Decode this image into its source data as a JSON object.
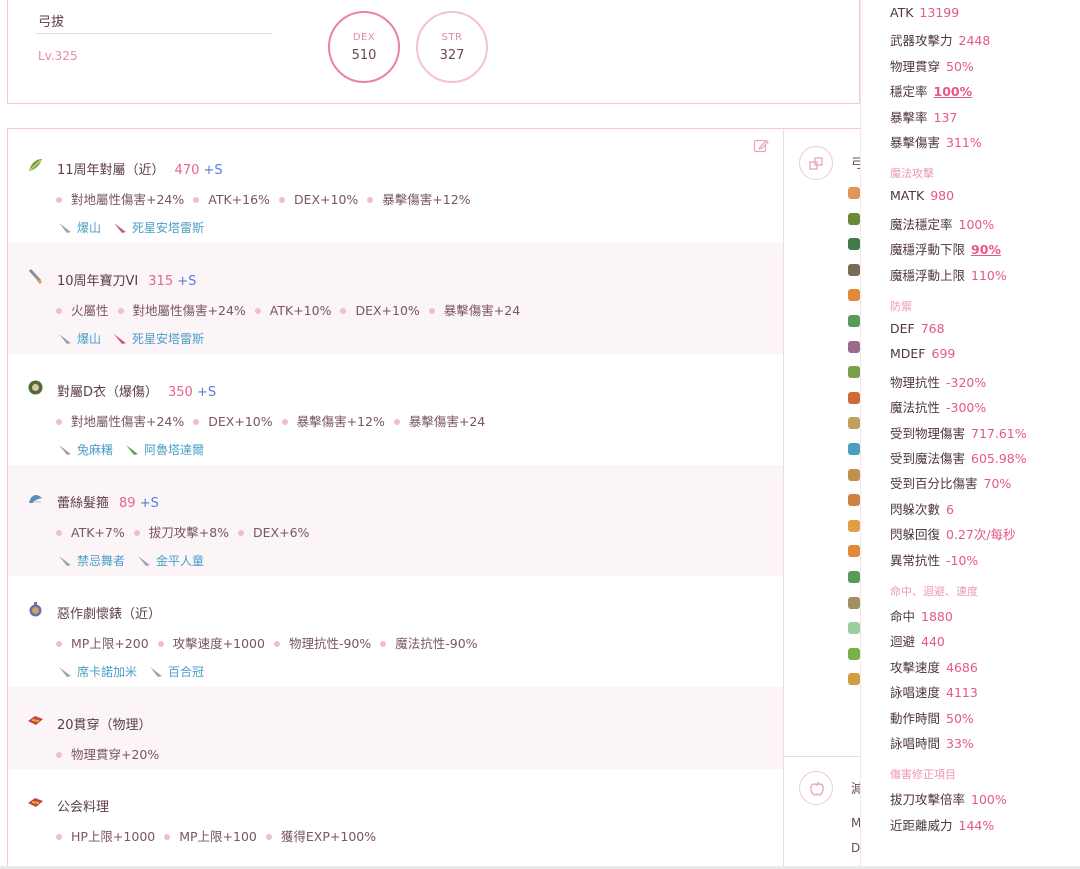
{
  "character": {
    "name": "弓拔",
    "level": "Lv.325",
    "stats": [
      {
        "label": "DEX",
        "value": "510"
      },
      {
        "label": "STR",
        "value": "327"
      }
    ]
  },
  "equipment": [
    {
      "slot_icon": "bow-icon",
      "name": "11周年對屬（近）",
      "refine": "470",
      "plus": "+S",
      "stats": [
        "對地屬性傷害+24%",
        "ATK+16%",
        "DEX+10%",
        "暴擊傷害+12%"
      ],
      "xtals": [
        "爆山",
        "死星安塔雷斯"
      ]
    },
    {
      "slot_icon": "katana-icon",
      "name": "10周年寶刀VI",
      "refine": "315",
      "plus": "+S",
      "stats": [
        "火屬性",
        "對地屬性傷害+24%",
        "ATK+10%",
        "DEX+10%",
        "暴擊傷害+24"
      ],
      "xtals": [
        "爆山",
        "死星安塔雷斯"
      ]
    },
    {
      "slot_icon": "armor-icon",
      "name": "對屬D衣（爆傷）",
      "refine": "350",
      "plus": "+S",
      "stats": [
        "對地屬性傷害+24%",
        "DEX+10%",
        "暴擊傷害+12%",
        "暴擊傷害+24"
      ],
      "xtals": [
        "兔麻糬",
        "阿魯塔達爾"
      ]
    },
    {
      "slot_icon": "hair-accessory-icon",
      "name": "蕾絲髮箍",
      "refine": "89",
      "plus": "+S",
      "stats": [
        "ATK+7%",
        "拔刀攻擊+8%",
        "DEX+6%"
      ],
      "xtals": [
        "禁忌舞者",
        "金平人童"
      ]
    },
    {
      "slot_icon": "pocket-watch-icon",
      "name": "惡作劇懷錶（近）",
      "refine": "",
      "plus": "",
      "stats": [
        "MP上限+200",
        "攻擊速度+1000",
        "物理抗性-90%",
        "魔法抗性-90%"
      ],
      "xtals": [
        "席卡諾加米",
        "百合冠"
      ]
    },
    {
      "slot_icon": "consumable-icon",
      "name": "20貫穿（物理）",
      "refine": "",
      "plus": "",
      "stats": [
        "物理貫穿+20%"
      ],
      "xtals": []
    },
    {
      "slot_icon": "consumable-icon",
      "name": "公会料理",
      "refine": "",
      "plus": "",
      "stats": [
        "HP上限+1000",
        "MP上限+100",
        "獲得EXP+100%"
      ],
      "xtals": []
    }
  ],
  "middle": {
    "header1": "弓",
    "header2": "減",
    "texts": [
      "M",
      "D"
    ]
  },
  "stat_panel": {
    "lines": [
      {
        "type": "stat",
        "label": "ATK",
        "value": "13199"
      },
      {
        "type": "stat",
        "label": "武器攻擊力",
        "value": "2448"
      },
      {
        "type": "stat",
        "label": "物理貫穿",
        "value": "50%"
      },
      {
        "type": "stat",
        "label": "穩定率",
        "value": "100%",
        "underline": true
      },
      {
        "type": "stat",
        "label": "暴擊率",
        "value": "137"
      },
      {
        "type": "stat",
        "label": "暴擊傷害",
        "value": "311%"
      },
      {
        "type": "head",
        "label": "魔法攻擊"
      },
      {
        "type": "stat",
        "label": "MATK",
        "value": "980"
      },
      {
        "type": "stat",
        "label": "魔法穩定率",
        "value": "100%"
      },
      {
        "type": "stat",
        "label": "魔穩浮動下限",
        "value": "90%",
        "underline": true
      },
      {
        "type": "stat",
        "label": "魔穩浮動上限",
        "value": "110%"
      },
      {
        "type": "head",
        "label": "防禦"
      },
      {
        "type": "stat",
        "label": "DEF",
        "value": "768"
      },
      {
        "type": "stat",
        "label": "MDEF",
        "value": "699"
      },
      {
        "type": "stat",
        "label": "物理抗性",
        "value": "-320%"
      },
      {
        "type": "stat",
        "label": "魔法抗性",
        "value": "-300%"
      },
      {
        "type": "stat",
        "label": "受到物理傷害",
        "value": "717.61%"
      },
      {
        "type": "stat",
        "label": "受到魔法傷害",
        "value": "605.98%"
      },
      {
        "type": "stat",
        "label": "受到百分比傷害",
        "value": "70%"
      },
      {
        "type": "stat",
        "label": "閃躲次數",
        "value": "6"
      },
      {
        "type": "stat",
        "label": "閃躲回復",
        "value": "0.27次/每秒"
      },
      {
        "type": "stat",
        "label": "異常抗性",
        "value": "-10%"
      },
      {
        "type": "head",
        "label": "命中、迴避、速度"
      },
      {
        "type": "stat",
        "label": "命中",
        "value": "1880"
      },
      {
        "type": "stat",
        "label": "迴避",
        "value": "440"
      },
      {
        "type": "stat",
        "label": "攻擊速度",
        "value": "4686"
      },
      {
        "type": "stat",
        "label": "詠唱速度",
        "value": "4113"
      },
      {
        "type": "stat",
        "label": "動作時間",
        "value": "50%"
      },
      {
        "type": "stat",
        "label": "詠唱時間",
        "value": "33%"
      },
      {
        "type": "head",
        "label": "傷害修正項目"
      },
      {
        "type": "stat",
        "label": "拔刀攻擊倍率",
        "value": "100%"
      },
      {
        "type": "stat",
        "label": "近距離威力",
        "value": "144%"
      }
    ]
  },
  "colors": {
    "accent": "#e4578c",
    "border": "#f3c9d4",
    "link": "#4a9fc7",
    "plus": "#5b7bd6"
  }
}
